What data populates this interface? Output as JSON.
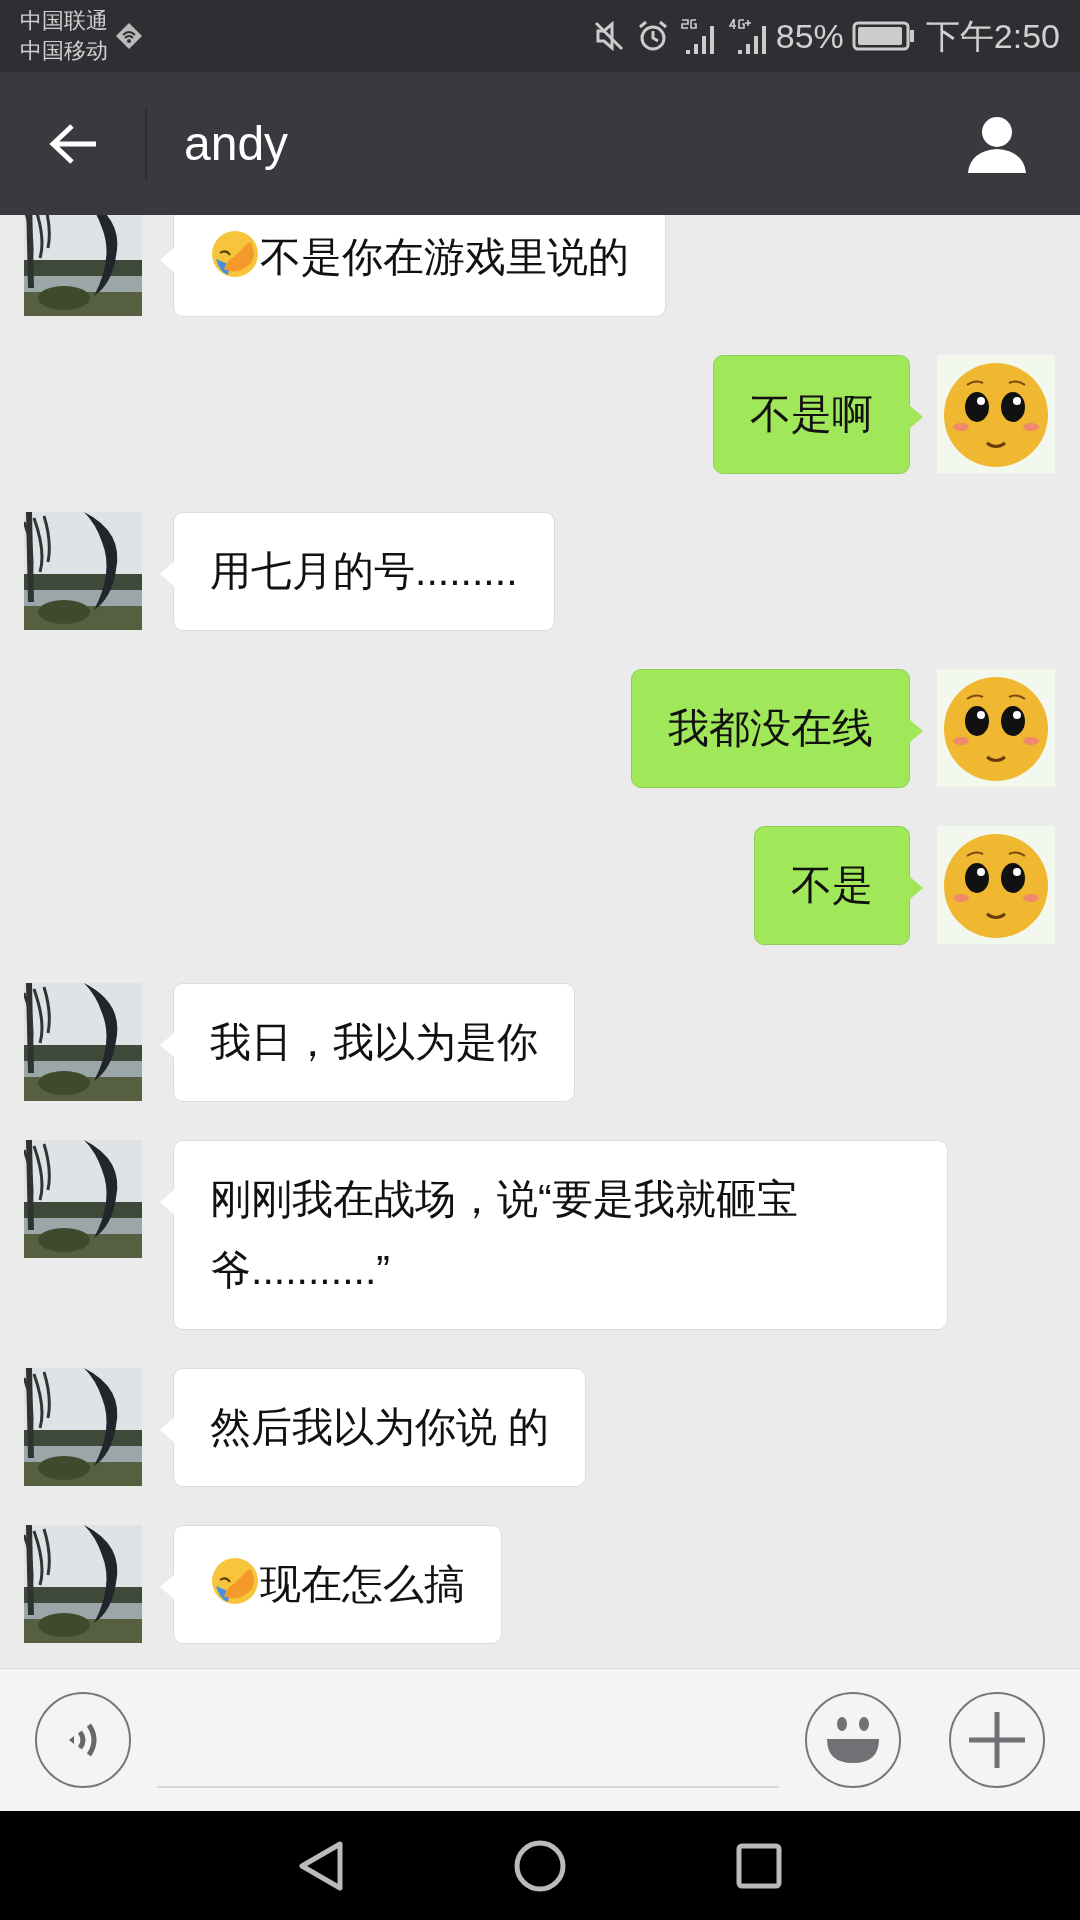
{
  "status_bar": {
    "carriers": [
      "中国联通",
      "中国移动"
    ],
    "battery": "85%",
    "time": "下午2:50"
  },
  "header": {
    "title": "andy"
  },
  "messages": [
    {
      "kind": "left",
      "text": "不是你在游戏里说的",
      "leading_emoji": true
    },
    {
      "kind": "right",
      "text": "不是啊",
      "leading_emoji": false
    },
    {
      "kind": "left",
      "text": "用七月的号.........",
      "leading_emoji": false
    },
    {
      "kind": "right",
      "text": "我都没在线",
      "leading_emoji": false
    },
    {
      "kind": "right",
      "text": "不是",
      "leading_emoji": false
    },
    {
      "kind": "left",
      "text": "我日，我以为是你",
      "leading_emoji": false
    },
    {
      "kind": "left",
      "text": "刚刚我在战场，说“要是我就砸宝爷...........”",
      "leading_emoji": false
    },
    {
      "kind": "left",
      "text": "然后我以为你说 的",
      "leading_emoji": false
    },
    {
      "kind": "left",
      "text": "现在怎么搞",
      "leading_emoji": true
    }
  ]
}
